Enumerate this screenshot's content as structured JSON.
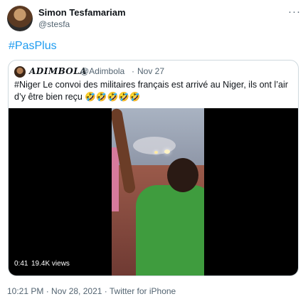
{
  "author": {
    "name": "Simon Tesfamariam",
    "handle": "@stesfa"
  },
  "tweet": {
    "hashtag": "#PasPlus"
  },
  "quoted": {
    "name": "𝑨𝑫𝑰𝑴𝑩𝑶𝑳𝑨",
    "handle": "@Adimbola",
    "separator": "·",
    "date": "Nov 27",
    "text": "#Niger Le convoi des militaires français est arrivé au Niger, ils ont l’air d’y être bien reçu 🤣🤣🤣🤣🤣",
    "video": {
      "time": "0:41",
      "views": "19.4K views"
    }
  },
  "footer": {
    "meta": "10:21 PM · Nov 28, 2021 · Twitter for iPhone"
  },
  "icons": {
    "more": "more-options-icon"
  },
  "colors": {
    "link": "#1d9bf0",
    "muted": "#536471",
    "border": "#cfd9de"
  }
}
